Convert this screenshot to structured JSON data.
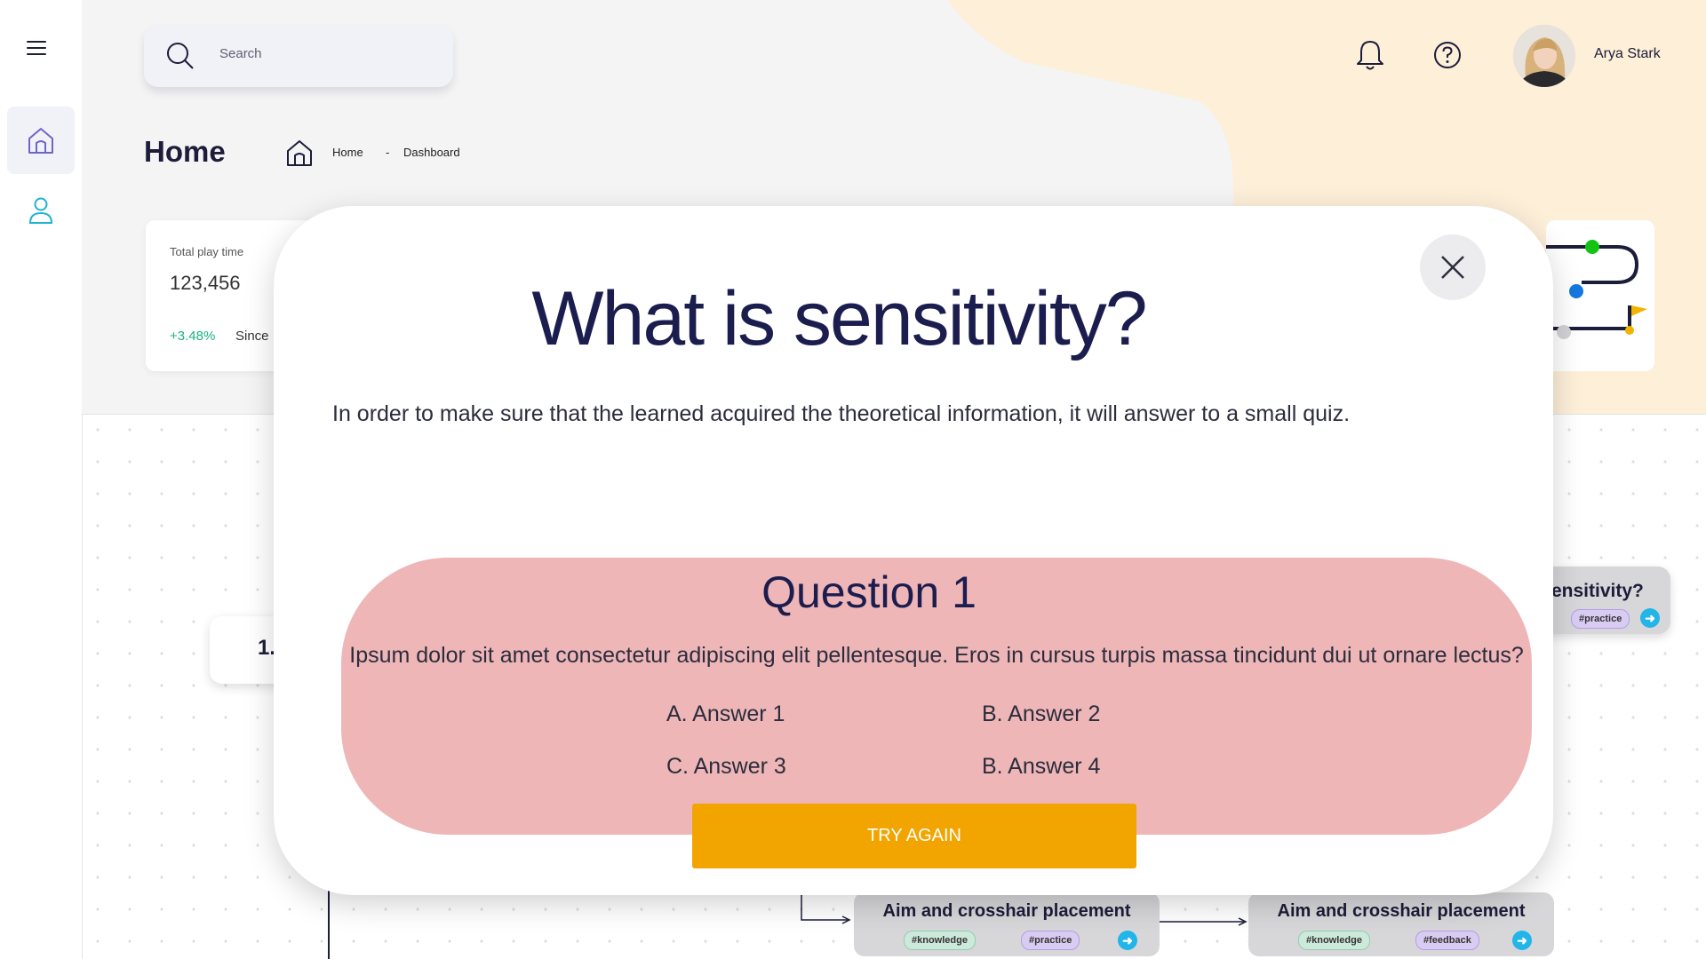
{
  "app": {
    "title": "Home"
  },
  "sidebar": {
    "menu_icon": "hamburger-menu-icon",
    "items": [
      {
        "icon": "home-icon"
      },
      {
        "icon": "user-icon"
      }
    ]
  },
  "header": {
    "search": {
      "placeholder": "Search",
      "icon": "search-icon"
    },
    "notifications_icon": "bell-icon",
    "help_icon": "help-circle-icon",
    "user": {
      "name": "Arya Stark"
    }
  },
  "breadcrumb": {
    "icon": "home-icon",
    "items": [
      "Home",
      "Dashboard"
    ],
    "separator": "-"
  },
  "stat_card": {
    "label": "Total play time",
    "value": "123,456",
    "change": "+3.48%",
    "since": "Since"
  },
  "map": {
    "node_left_label": "1.",
    "node_right_title": "ensitivity?",
    "node_right_tag": "#practice",
    "node_bottom_1": {
      "title": "Aim and crosshair placement",
      "tags": [
        "#knowledge",
        "#practice"
      ]
    },
    "node_bottom_2": {
      "title": "Aim and crosshair placement",
      "tags": [
        "#knowledge",
        "#feedback"
      ]
    }
  },
  "modal": {
    "title": "What is sensitivity?",
    "description": "In order to make sure that the learned acquired the theoretical information, it will answer to a small quiz.",
    "close_icon": "close-icon",
    "question": {
      "title": "Question 1",
      "text": "Ipsum dolor sit amet consectetur adipiscing elit pellentesque. Eros in cursus turpis massa tincidunt dui ut ornare lectus?",
      "answers": [
        "A. Answer 1",
        "B. Answer 2",
        "C. Answer 3",
        "B. Answer 4"
      ]
    },
    "try_again_label": "TRY AGAIN"
  },
  "colors": {
    "accent": "#f2a500",
    "question_bg": "#efb6b8",
    "title": "#1b1d4e",
    "positive": "#19b37b",
    "header_blob": "#fdefd8"
  }
}
